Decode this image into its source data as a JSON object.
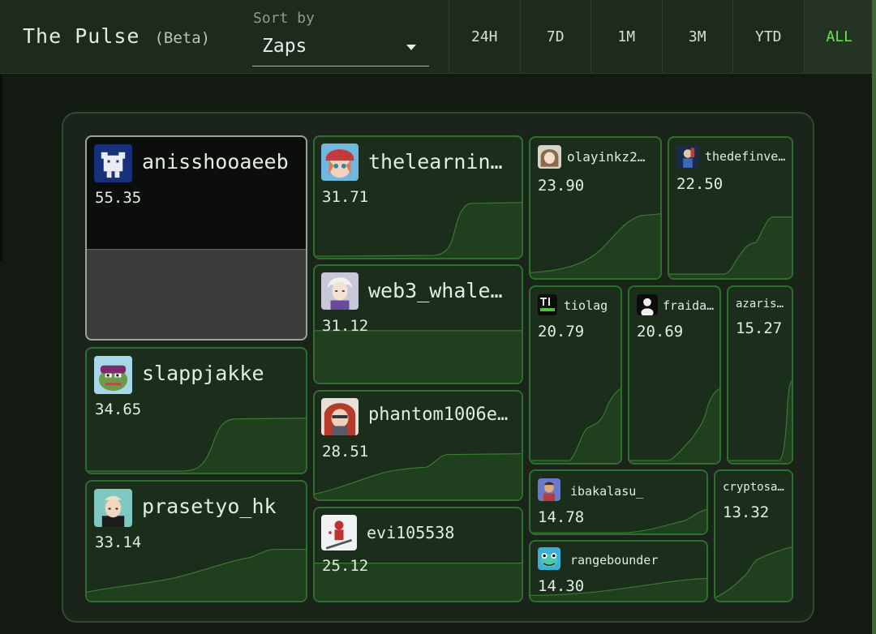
{
  "header": {
    "title": "The Pulse",
    "beta": "(Beta)",
    "sort_label": "Sort by",
    "sort_value": "Zaps",
    "tabs": [
      "24H",
      "7D",
      "1M",
      "3M",
      "YTD",
      "ALL"
    ],
    "active_tab": "ALL"
  },
  "colors": {
    "accent": "#6de04d",
    "tile_border": "#2e6e2e",
    "tile_bg": "#1b2d1b",
    "spark_fill": "#1f3f1f",
    "spark_line": "#3b7a32"
  },
  "users": [
    {
      "name": "anisshooaeeb",
      "value": "55.35",
      "avatar": "pixel-bear-avatar"
    },
    {
      "name": "thelearnin…",
      "value": "31.71",
      "avatar": "anime-girl-red-hat-avatar"
    },
    {
      "name": "olayinkz2…",
      "value": "23.90",
      "avatar": "anime-girl-avatar"
    },
    {
      "name": "thedefinve…",
      "value": "22.50",
      "avatar": "character-avatar"
    },
    {
      "name": "web3_whale…",
      "value": "31.12",
      "avatar": "white-hair-avatar"
    },
    {
      "name": "tiolag",
      "value": "20.79",
      "avatar": "tio-lag-logo-avatar"
    },
    {
      "name": "fraida…",
      "value": "20.69",
      "avatar": "silhouette-avatar"
    },
    {
      "name": "azaris…",
      "value": "15.27",
      "avatar": ""
    },
    {
      "name": "slappjakke",
      "value": "34.65",
      "avatar": "pepe-frog-avatar"
    },
    {
      "name": "phantom1006e…",
      "value": "28.51",
      "avatar": "red-hood-avatar"
    },
    {
      "name": "ibakalasu_",
      "value": "14.78",
      "avatar": "man-avatar"
    },
    {
      "name": "cryptosa…",
      "value": "13.32",
      "avatar": ""
    },
    {
      "name": "prasetyo_hk",
      "value": "33.14",
      "avatar": "anime-boy-avatar"
    },
    {
      "name": "evi105538",
      "value": "25.12",
      "avatar": "skier-avatar"
    },
    {
      "name": "rangebounder",
      "value": "14.30",
      "avatar": "frog-mascot-avatar"
    }
  ]
}
